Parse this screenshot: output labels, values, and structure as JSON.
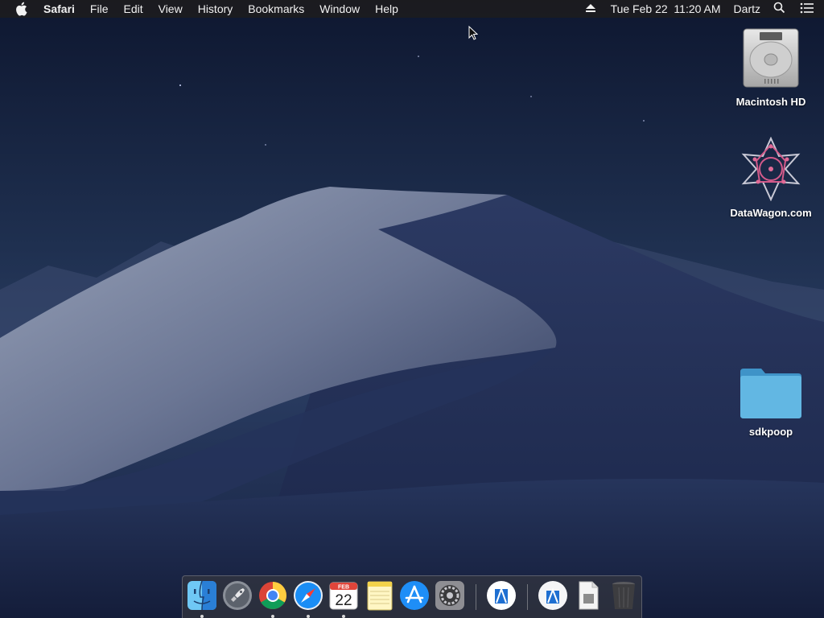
{
  "menubar": {
    "apple_icon": "apple-icon",
    "app_name": "Safari",
    "menus": [
      "File",
      "Edit",
      "View",
      "History",
      "Bookmarks",
      "Window",
      "Help"
    ],
    "eject_icon": "eject-icon",
    "clock": "Tue Feb 22  11:20 AM",
    "user": "Dartz",
    "search_icon": "spotlight-search-icon",
    "list_icon": "notification-center-icon"
  },
  "desktop": {
    "icons": [
      {
        "label": "Macintosh HD",
        "icon": "hard-drive-icon"
      },
      {
        "label": "DataWagon.com",
        "icon": "datawagon-star-icon"
      },
      {
        "label": "sdkpoop",
        "icon": "folder-icon"
      }
    ]
  },
  "dock": {
    "apps": [
      {
        "name": "Finder",
        "icon": "finder-icon",
        "running": true
      },
      {
        "name": "Launchpad",
        "icon": "launchpad-icon",
        "running": false
      },
      {
        "name": "Google Chrome",
        "icon": "chrome-icon",
        "running": true
      },
      {
        "name": "Safari",
        "icon": "safari-icon",
        "running": true
      },
      {
        "name": "Calendar",
        "icon": "calendar-icon",
        "running": true,
        "month": "FEB",
        "day": "22"
      },
      {
        "name": "Notes",
        "icon": "notes-icon",
        "running": false
      },
      {
        "name": "App Store",
        "icon": "app-store-icon",
        "running": false
      },
      {
        "name": "System Preferences",
        "icon": "system-preferences-icon",
        "running": false
      },
      {
        "name": "Xcode Instruments",
        "icon": "instruments-icon",
        "running": false
      },
      {
        "name": "Downloads Stack",
        "icon": "downloads-stack-icon",
        "running": false
      },
      {
        "name": "Documents Stack",
        "icon": "documents-stack-icon",
        "running": false
      },
      {
        "name": "Trash",
        "icon": "trash-icon",
        "running": false
      }
    ]
  },
  "colors": {
    "menubar_bg": "#1c1c1e",
    "folder_blue": "#5bb5e0",
    "safari_blue": "#1a8df5"
  }
}
